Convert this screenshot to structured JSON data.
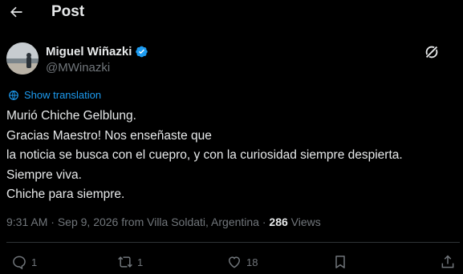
{
  "header": {
    "title": "Post"
  },
  "author": {
    "name": "Miguel Wiñazki",
    "handle": "@MWinazki",
    "verified_color": "#1d9bf0"
  },
  "translate_label": "Show translation",
  "tweet": {
    "lines": [
      "Murió Chiche Gelblung.",
      "Gracias Maestro! Nos enseñaste que",
      "la noticia se busca con el cuepro, y con la curiosidad siempre despierta.",
      "Siempre viva.",
      "Chiche para siempre."
    ]
  },
  "meta": {
    "time": "9:31 AM",
    "date": "Sep 9, 2026",
    "location": "from Villa Soldati, Argentina",
    "views": "286",
    "views_label": "Views"
  },
  "actions": {
    "replies": "1",
    "reposts": "1",
    "likes": "18"
  },
  "colors": {
    "background": "#000000",
    "text": "#e7e9ea",
    "secondary": "#71767b",
    "accent": "#1d9bf0",
    "divider": "#2f3336"
  },
  "icons": [
    "back-arrow-icon",
    "verified-badge-icon",
    "grok-icon",
    "translate-icon",
    "reply-icon",
    "repost-icon",
    "like-icon",
    "bookmark-icon",
    "share-icon"
  ]
}
